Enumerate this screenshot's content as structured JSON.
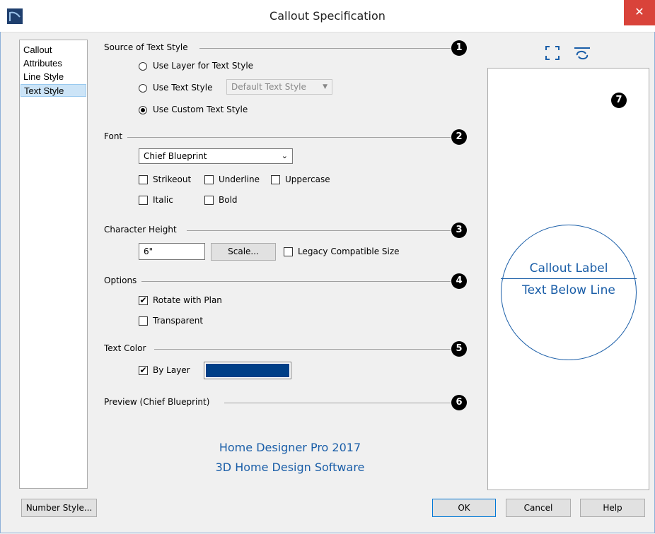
{
  "window": {
    "title": "Callout Specification",
    "close_glyph": "✕"
  },
  "nav": {
    "items": [
      "Callout",
      "Attributes",
      "Line Style",
      "Text Style"
    ],
    "selected": "Text Style"
  },
  "source": {
    "header": "Source of Text Style",
    "badge": "1",
    "use_layer": "Use Layer for Text Style",
    "use_text_style": "Use Text Style",
    "text_style_value": "Default Text Style",
    "use_custom": "Use Custom Text Style"
  },
  "font": {
    "header": "Font",
    "badge": "2",
    "family": "Chief Blueprint",
    "strikeout": "Strikeout",
    "underline": "Underline",
    "uppercase": "Uppercase",
    "italic": "Italic",
    "bold": "Bold"
  },
  "height": {
    "header": "Character Height",
    "badge": "3",
    "value": "6\"",
    "scale_button": "Scale...",
    "legacy": "Legacy Compatible Size"
  },
  "options": {
    "header": "Options",
    "badge": "4",
    "rotate": "Rotate with Plan",
    "transparent": "Transparent"
  },
  "color": {
    "header": "Text Color",
    "badge": "5",
    "by_layer": "By Layer",
    "swatch": "#003f87"
  },
  "preview_section": {
    "header": "Preview (Chief Blueprint)",
    "badge": "6"
  },
  "watermark": {
    "line1": "Home Designer Pro 2017",
    "line2": "3D Home Design Software"
  },
  "preview": {
    "badge": "7",
    "label": "Callout Label",
    "below": "Text Below Line"
  },
  "footer": {
    "number_style": "Number Style...",
    "ok": "OK",
    "cancel": "Cancel",
    "help": "Help"
  },
  "icons": [
    "fill-window-icon",
    "refresh-view-icon"
  ],
  "colors": {
    "accent": "#1a5ea8",
    "close": "#d9433a"
  }
}
